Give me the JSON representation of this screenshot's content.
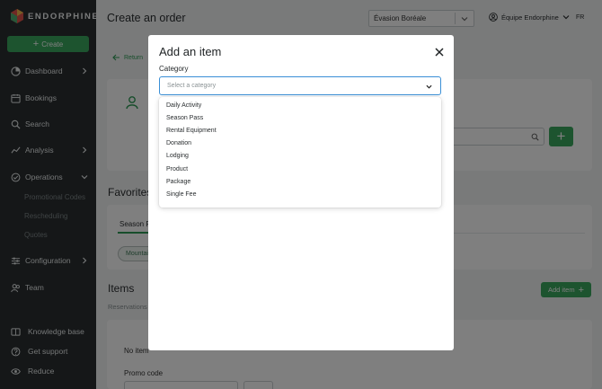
{
  "sidebar": {
    "brand": "ENDORPHINE",
    "create_label": "Create",
    "items": [
      {
        "label": "Dashboard",
        "icon": "dashboard-icon"
      },
      {
        "label": "Bookings",
        "icon": "calendar-icon"
      },
      {
        "label": "Search",
        "icon": "search-icon"
      },
      {
        "label": "Analysis",
        "icon": "chart-icon"
      },
      {
        "label": "Operations",
        "icon": "operations-icon"
      },
      {
        "label": "Configuration",
        "icon": "sliders-icon"
      },
      {
        "label": "Team",
        "icon": "team-icon"
      }
    ],
    "operations_sub": [
      "Promotional Codes",
      "Rescheduling",
      "Quotes"
    ],
    "bottom": [
      {
        "label": "Knowledge base",
        "icon": "book-icon"
      },
      {
        "label": "Get support",
        "icon": "help-icon"
      },
      {
        "label": "Reduce",
        "icon": "eye-icon"
      }
    ]
  },
  "header": {
    "title": "Create an order",
    "vendor": "Évasion Boréale",
    "user": "Équipe Endorphine",
    "lang": "FR"
  },
  "page": {
    "return_label": "Return",
    "favorites_title": "Favorites",
    "favorites_tab": "Season P",
    "favorites_chip": "Mountai",
    "items_title": "Items",
    "items_sub": "Reservations",
    "add_item_label": "Add item",
    "no_items": "No item",
    "promo_label": "Promo code"
  },
  "modal": {
    "title": "Add an item",
    "category_label": "Category",
    "category_placeholder": "Select a category",
    "options": [
      "Daily Activity",
      "Season Pass",
      "Rental Equipment",
      "Donation",
      "Lodging",
      "Product",
      "Package",
      "Single Fee"
    ]
  },
  "colors": {
    "sidebar_bg": "#2b2f31",
    "accent_green": "#3ba85f",
    "focus_blue": "#3a8fd6"
  }
}
